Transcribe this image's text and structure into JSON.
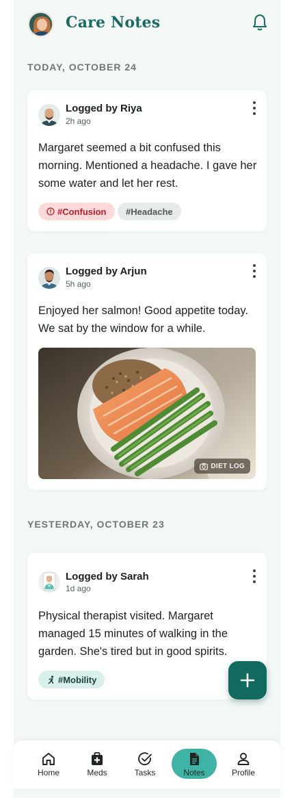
{
  "app": {
    "title": "Care Notes",
    "icons": {
      "avatar": "user-avatar-photo",
      "bell": "bell-icon"
    }
  },
  "sections": [
    {
      "label": "TODAY, OCTOBER 24"
    },
    {
      "label": "YESTERDAY, OCTOBER 23"
    }
  ],
  "notes": [
    {
      "author": "Logged by Riya",
      "time": "2h ago",
      "body": "Margaret seemed a bit confused this morning. Mentioned a headache. I gave her some water and let her rest.",
      "tags": [
        {
          "label": "#Confusion",
          "icon": "alert-circle-icon",
          "style": "red"
        },
        {
          "label": "#Headache",
          "style": "gray"
        }
      ]
    },
    {
      "author": "Logged by Arjun",
      "time": "5h ago",
      "body": "Enjoyed her salmon! Good appetite today. We sat by the window for a while.",
      "photo": {
        "description": "salmon-quinoa-asparagus-plate",
        "badge": "DIET LOG",
        "badge_icon": "camera-icon"
      }
    },
    {
      "author": "Logged by Sarah",
      "time": "1d ago",
      "body": "Physical therapist visited. Margaret managed 15 minutes of walking in the garden. She's tired but in good spirits.",
      "tags": [
        {
          "label": "#Mobility",
          "icon": "walking-icon",
          "style": "teal"
        }
      ]
    }
  ],
  "fab": {
    "icon": "plus-icon"
  },
  "nav": {
    "items": [
      {
        "label": "Home",
        "icon": "home-icon"
      },
      {
        "label": "Meds",
        "icon": "medical-kit-icon"
      },
      {
        "label": "Tasks",
        "icon": "check-circle-icon"
      },
      {
        "label": "Notes",
        "icon": "document-icon",
        "active": true
      },
      {
        "label": "Profile",
        "icon": "person-icon"
      }
    ]
  },
  "colors": {
    "brand": "#1a6b62",
    "fab": "#126a5f",
    "nav_active": "#3fb3a6",
    "background": "#f3f8f7",
    "tag_red": "#fcd9da",
    "tag_teal": "#d8efec"
  }
}
